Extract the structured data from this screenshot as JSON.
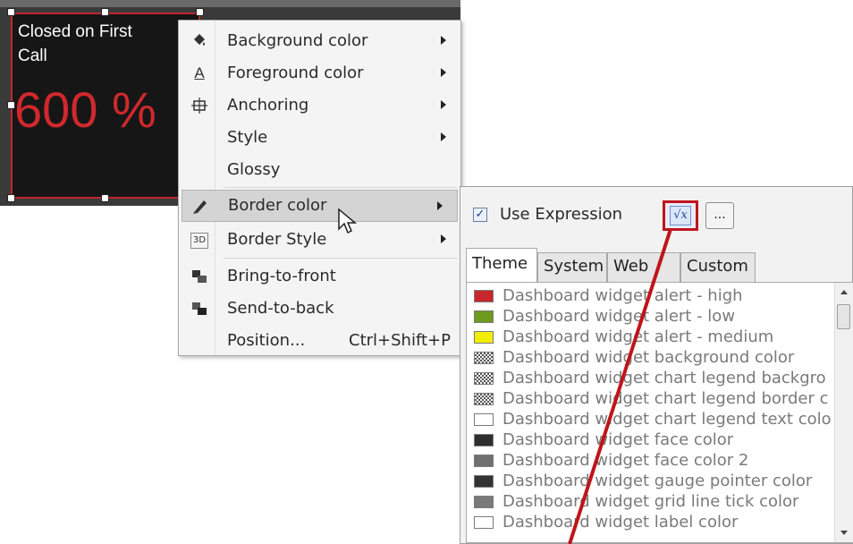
{
  "colors": {
    "accent_red": "#c0141c",
    "widget_bg": "#161616",
    "widget_value": "#d0282d"
  },
  "widget": {
    "title": "Closed on First Call",
    "value": "600 %"
  },
  "context_menu": {
    "items": [
      {
        "label": "Background color",
        "icon": "paint-bucket-icon",
        "submenu": true
      },
      {
        "label": "Foreground color",
        "icon": "font-color-icon",
        "submenu": true
      },
      {
        "label": "Anchoring",
        "icon": "anchoring-icon",
        "submenu": true
      },
      {
        "label": "Style",
        "icon": "",
        "submenu": true
      },
      {
        "label": "Glossy",
        "icon": "",
        "submenu": false
      },
      {
        "label": "Border color",
        "icon": "pencil-icon",
        "submenu": true,
        "highlighted": true
      },
      {
        "label": "Border Style",
        "icon": "border-style-3d-icon",
        "submenu": true
      },
      {
        "label": "Bring-to-front",
        "icon": "bring-to-front-icon",
        "submenu": false
      },
      {
        "label": "Send-to-back",
        "icon": "send-to-back-icon",
        "submenu": false
      },
      {
        "label": "Position...",
        "shortcut": "Ctrl+Shift+P",
        "icon": "",
        "submenu": false
      }
    ]
  },
  "picker": {
    "use_expression_label": "Use Expression",
    "use_expression_checked": true,
    "fx_label": "√x",
    "more_label": "...",
    "tabs": [
      "Theme",
      "System",
      "Web",
      "Custom"
    ],
    "active_tab": "Theme",
    "colors": [
      {
        "label": "Dashboard widget alert - high",
        "swatch": "#c8282d"
      },
      {
        "label": "Dashboard widget alert - low",
        "swatch": "#6e9a1e"
      },
      {
        "label": "Dashboard widget alert - medium",
        "swatch": "#f2ee00"
      },
      {
        "label": "Dashboard widget background color",
        "swatch": "checker"
      },
      {
        "label": "Dashboard widget chart legend backgro",
        "swatch": "checker"
      },
      {
        "label": "Dashboard widget chart legend border c",
        "swatch": "checker"
      },
      {
        "label": "Dashboard widget chart legend text colo",
        "swatch": "#ffffff"
      },
      {
        "label": "Dashboard widget face color",
        "swatch": "#2e2e2e"
      },
      {
        "label": "Dashboard widget face color 2",
        "swatch": "#707070"
      },
      {
        "label": "Dashboard widget gauge pointer color",
        "swatch": "#333333"
      },
      {
        "label": "Dashboard widget grid line tick color",
        "swatch": "#7a7a7a"
      },
      {
        "label": "Dashboard widget label color",
        "swatch": "#ffffff"
      }
    ]
  }
}
